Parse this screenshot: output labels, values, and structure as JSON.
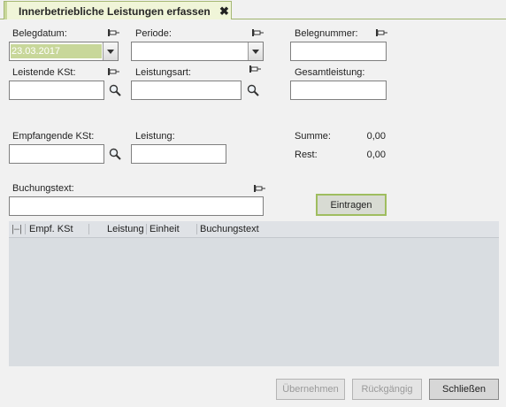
{
  "tab": {
    "title": "Innerbetriebliche Leistungen erfassen",
    "close": "✖"
  },
  "form": {
    "belegdatum": {
      "label": "Belegdatum:",
      "value": "23.03.2017"
    },
    "periode": {
      "label": "Periode:",
      "value": ""
    },
    "belegnummer": {
      "label": "Belegnummer:",
      "value": ""
    },
    "leistende_kst": {
      "label": "Leistende KSt:",
      "value": ""
    },
    "leistungsart": {
      "label": "Leistungsart:",
      "value": ""
    },
    "gesamtleistung": {
      "label": "Gesamtleistung:",
      "value": ""
    },
    "empfangende_kst": {
      "label": "Empfangende KSt:",
      "value": ""
    },
    "leistung": {
      "label": "Leistung:",
      "value": ""
    },
    "buchungstext": {
      "label": "Buchungstext:",
      "value": ""
    }
  },
  "summary": {
    "summe_label": "Summe:",
    "summe_value": "0,00",
    "rest_label": "Rest:",
    "rest_value": "0,00"
  },
  "buttons": {
    "eintragen": "Eintragen",
    "uebernehmen": "Übernehmen",
    "rueckgaengig": "Rückgängig",
    "schliessen": "Schließen"
  },
  "grid": {
    "handle": "|–|",
    "columns": [
      "Empf. KSt",
      "Leistung",
      "Einheit",
      "Buchungstext"
    ],
    "rows": []
  },
  "colors": {
    "accent": "#9fbd5f",
    "date_highlight": "#c8d79a"
  }
}
